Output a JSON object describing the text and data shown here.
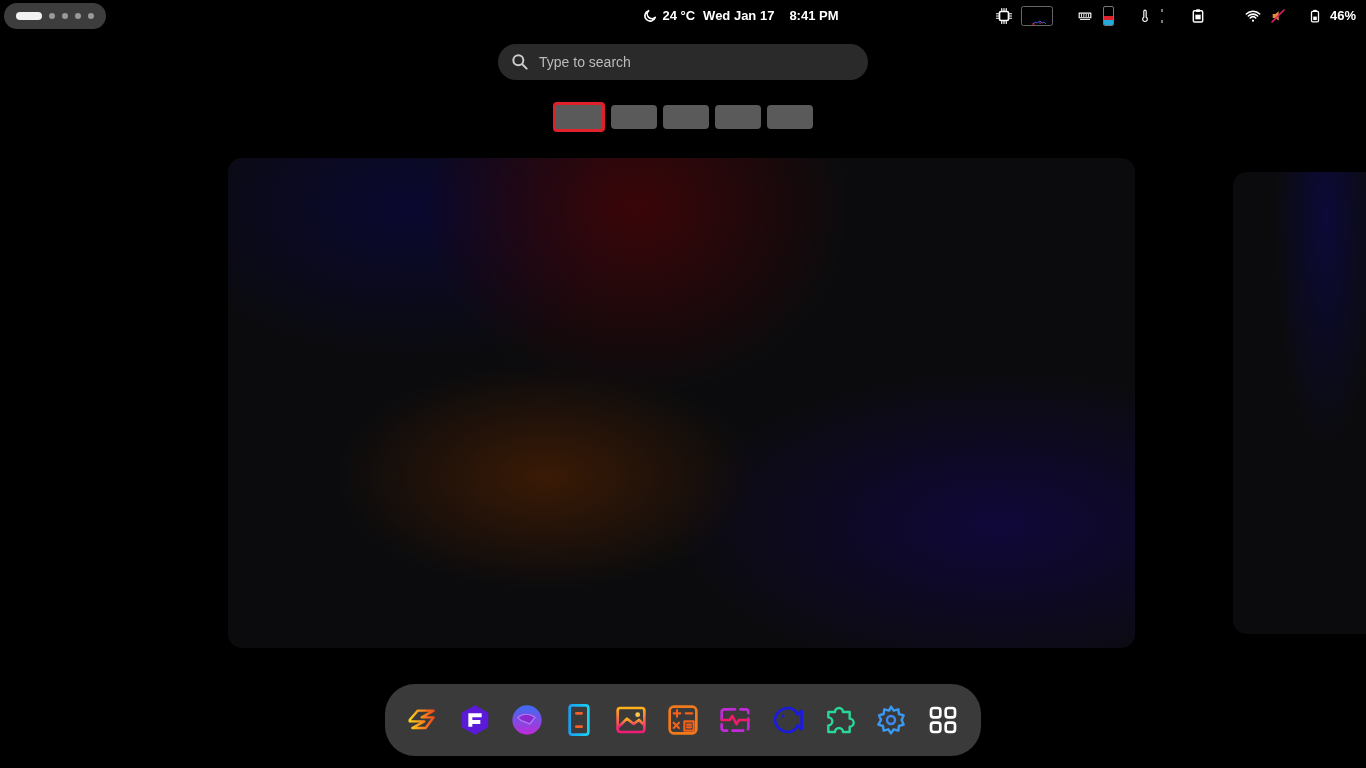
{
  "top_bar": {
    "workspaces": [
      {
        "selected": true
      },
      {
        "selected": false
      },
      {
        "selected": false
      },
      {
        "selected": false
      },
      {
        "selected": false
      }
    ],
    "weather": "24 °C",
    "date": "Wed Jan 17",
    "time": "8:41 PM",
    "battery": "46%",
    "memory_meter": {
      "level": 0.5
    }
  },
  "search": {
    "placeholder": "Type to search"
  },
  "workspace_thumbnails": [
    {
      "selected": true
    },
    {
      "selected": false
    },
    {
      "selected": false
    },
    {
      "selected": false
    },
    {
      "selected": false
    }
  ]
}
